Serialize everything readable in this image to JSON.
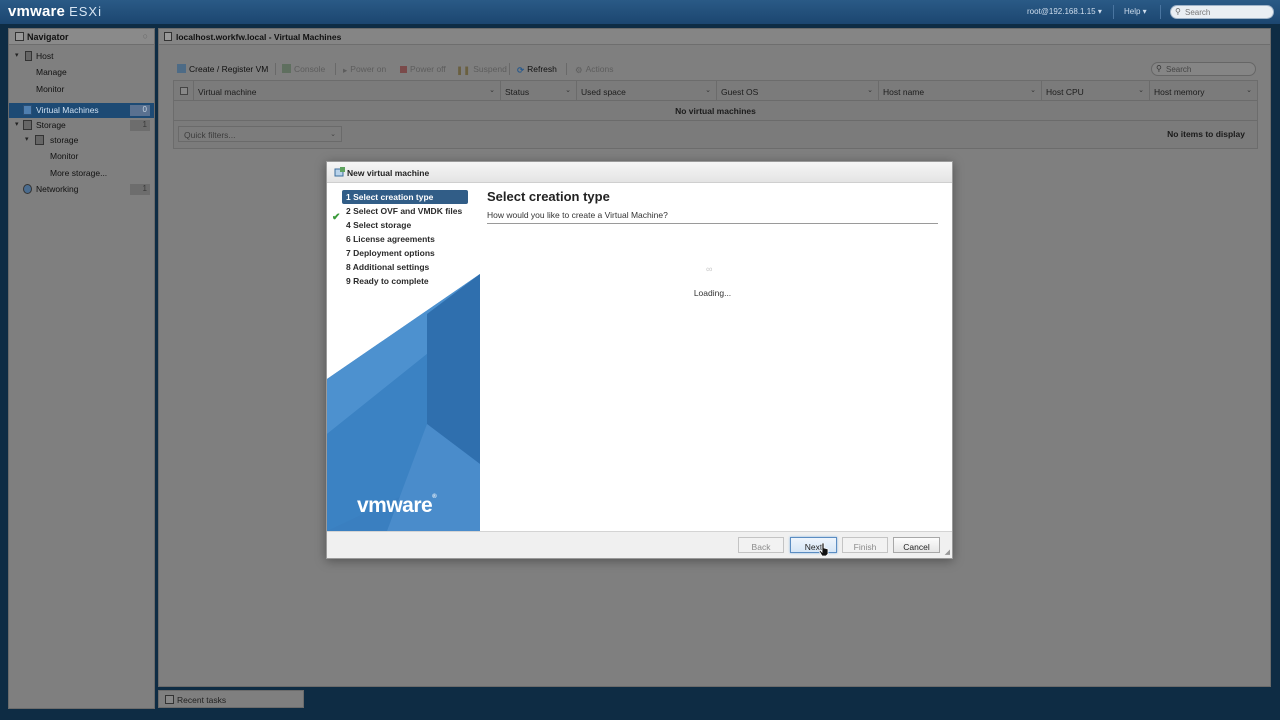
{
  "topbar": {
    "brand": "vmware",
    "product": "ESXi",
    "user": "root@192.168.1.15 ▾",
    "help": "Help ▾",
    "search_placeholder": "Search"
  },
  "navigator": {
    "title": "Navigator",
    "items": [
      {
        "label": "Host"
      },
      {
        "label": "Manage"
      },
      {
        "label": "Monitor"
      },
      {
        "label": "Virtual Machines",
        "badge": "0"
      },
      {
        "label": "Storage",
        "badge": "1"
      },
      {
        "label": "storage"
      },
      {
        "label": "Monitor"
      },
      {
        "label": "More storage..."
      },
      {
        "label": "Networking",
        "badge": "1"
      }
    ]
  },
  "main": {
    "title": "localhost.workfw.local - Virtual Machines",
    "toolbar": {
      "create": "Create / Register VM",
      "console": "Console",
      "power_on": "Power on",
      "power_off": "Power off",
      "suspend": "Suspend",
      "refresh": "Refresh",
      "actions": "Actions"
    },
    "search_placeholder": "Search",
    "columns": [
      "Virtual machine",
      "Status",
      "Used space",
      "Guest OS",
      "Host name",
      "Host CPU",
      "Host memory"
    ],
    "empty_message": "No virtual machines",
    "quick_filters": "Quick filters...",
    "no_items": "No items to display"
  },
  "bottom": {
    "recent_tasks": "Recent tasks"
  },
  "dialog": {
    "title": "New virtual machine",
    "steps": [
      "1 Select creation type",
      "2 Select OVF and VMDK files",
      "4 Select storage",
      "6 License agreements",
      "7 Deployment options",
      "8 Additional settings",
      "9 Ready to complete"
    ],
    "active_step": 0,
    "heading": "Select creation type",
    "question": "How would you like to create a Virtual Machine?",
    "loading": "Loading...",
    "logo": "vmware",
    "buttons": {
      "back": "Back",
      "next": "Next",
      "finish": "Finish",
      "cancel": "Cancel"
    }
  },
  "colors": {
    "topbar": "#1c4670",
    "selected_nav": "#1d4a74",
    "active_step": "#315d87",
    "art_blue": "#3a7fc0",
    "check_green": "#3a9a3a"
  }
}
